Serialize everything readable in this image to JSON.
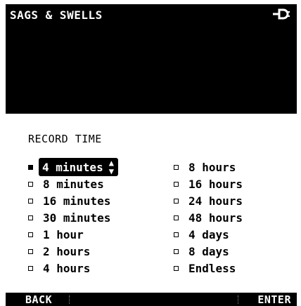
{
  "header": {
    "title": "SAGS & SWELLS",
    "power_icon": "plug-icon"
  },
  "panel": {
    "title": "RECORD TIME",
    "selected": "4 minutes",
    "options_left": [
      "4 minutes",
      "8 minutes",
      "16 minutes",
      "30 minutes",
      "1 hour",
      "2 hours",
      "4 hours"
    ],
    "options_right": [
      "8 hours",
      "16 hours",
      "24 hours",
      "48 hours",
      "4 days",
      "8 days",
      "Endless"
    ]
  },
  "softkeys": {
    "back": "BACK",
    "enter": "ENTER"
  },
  "colors": {
    "background": "#000000",
    "foreground": "#ffffff"
  }
}
